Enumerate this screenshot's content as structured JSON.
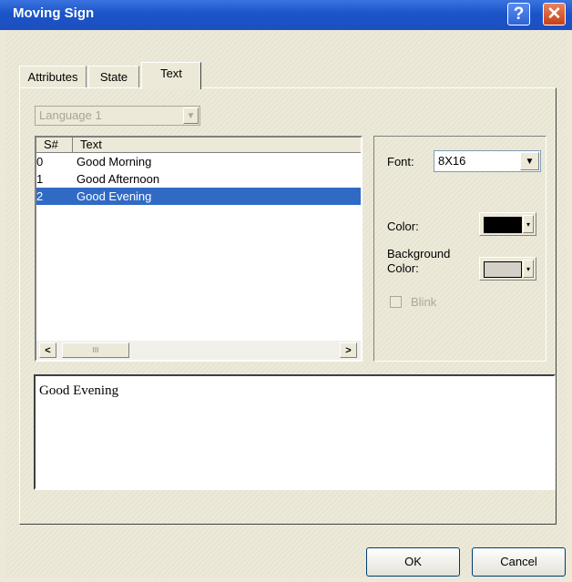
{
  "window": {
    "title": "Moving Sign",
    "help_glyph": "?",
    "close_glyph": "✕"
  },
  "tabs": [
    {
      "label": "Attributes"
    },
    {
      "label": "State"
    },
    {
      "label": "Text",
      "selected": true
    }
  ],
  "language_select": {
    "value": "Language 1",
    "disabled": true
  },
  "list": {
    "headers": {
      "sno": "S#",
      "text": "Text"
    },
    "rows": [
      {
        "sno": "0",
        "text": "Good Morning"
      },
      {
        "sno": "1",
        "text": "Good Afternoon"
      },
      {
        "sno": "2",
        "text": "Good Evening"
      }
    ],
    "selected_index": 2,
    "scroll_thumb_glyph": "III"
  },
  "properties": {
    "font_label": "Font:",
    "font_value": "8X16",
    "color_label": "Color:",
    "color_value": "#000000",
    "bg_label_line1": "Background",
    "bg_label_line2": "Color:",
    "bg_value": "#D4D0C8",
    "blink_label": "Blink",
    "blink_checked": false
  },
  "text_edit": {
    "value": "Good Evening"
  },
  "buttons": {
    "ok": "OK",
    "cancel": "Cancel"
  }
}
